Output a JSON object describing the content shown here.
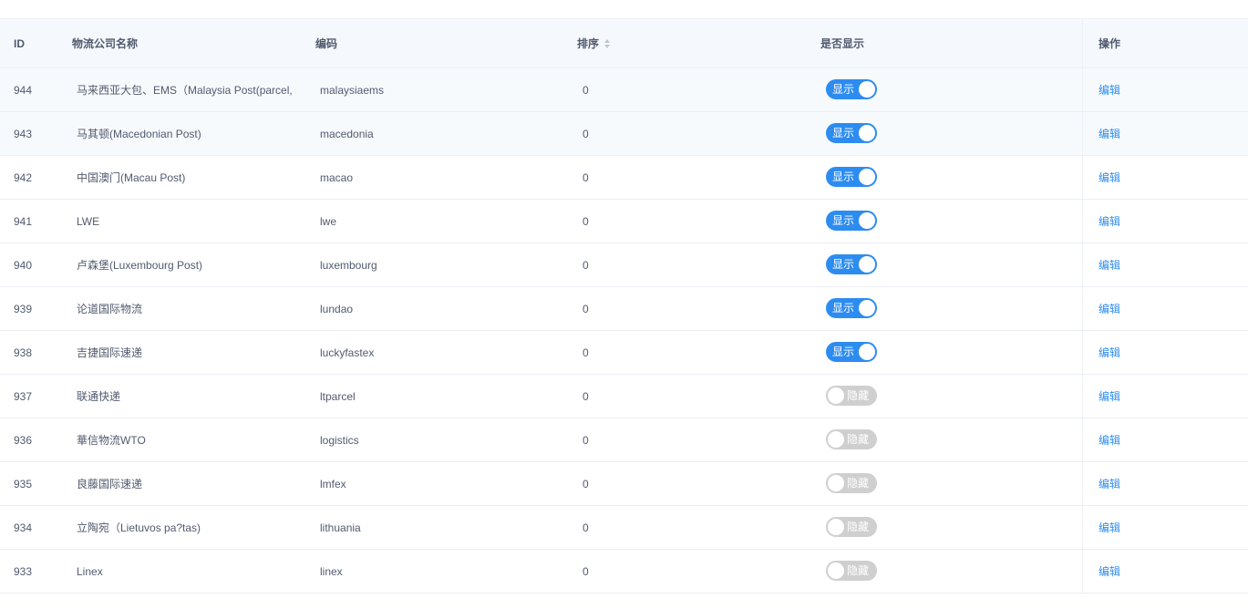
{
  "columns": {
    "id": "ID",
    "name": "物流公司名称",
    "code": "编码",
    "sort": "排序",
    "show": "是否显示",
    "op": "操作"
  },
  "colors": {
    "switch_on": "#2d8cf0",
    "switch_off": "#cfcfcf",
    "link": "#2d8cf0",
    "header_bg": "#f5f8fc"
  },
  "rows": [
    {
      "id": "944",
      "name": "马来西亚大包、EMS（Malaysia Post(parcel,",
      "code": "malaysiaems",
      "sort": "0",
      "show": true,
      "show_label": "显示",
      "op_label": "编辑"
    },
    {
      "id": "943",
      "name": "马其顿(Macedonian Post)",
      "code": "macedonia",
      "sort": "0",
      "show": true,
      "show_label": "显示",
      "op_label": "编辑"
    },
    {
      "id": "942",
      "name": "中国澳门(Macau Post)",
      "code": "macao",
      "sort": "0",
      "show": true,
      "show_label": "显示",
      "op_label": "编辑"
    },
    {
      "id": "941",
      "name": "LWE",
      "code": "lwe",
      "sort": "0",
      "show": true,
      "show_label": "显示",
      "op_label": "编辑"
    },
    {
      "id": "940",
      "name": "卢森堡(Luxembourg Post)",
      "code": "luxembourg",
      "sort": "0",
      "show": true,
      "show_label": "显示",
      "op_label": "编辑"
    },
    {
      "id": "939",
      "name": "论道国际物流",
      "code": "lundao",
      "sort": "0",
      "show": true,
      "show_label": "显示",
      "op_label": "编辑"
    },
    {
      "id": "938",
      "name": "吉捷国际速递",
      "code": "luckyfastex",
      "sort": "0",
      "show": true,
      "show_label": "显示",
      "op_label": "编辑"
    },
    {
      "id": "937",
      "name": "联通快递",
      "code": "ltparcel",
      "sort": "0",
      "show": false,
      "show_label": "隐藏",
      "op_label": "编辑"
    },
    {
      "id": "936",
      "name": "華信物流WTO",
      "code": "logistics",
      "sort": "0",
      "show": false,
      "show_label": "隐藏",
      "op_label": "编辑"
    },
    {
      "id": "935",
      "name": "良藤国际速递",
      "code": "lmfex",
      "sort": "0",
      "show": false,
      "show_label": "隐藏",
      "op_label": "编辑"
    },
    {
      "id": "934",
      "name": "立陶宛（Lietuvos pa?tas)",
      "code": "lithuania",
      "sort": "0",
      "show": false,
      "show_label": "隐藏",
      "op_label": "编辑"
    },
    {
      "id": "933",
      "name": "Linex",
      "code": "linex",
      "sort": "0",
      "show": false,
      "show_label": "隐藏",
      "op_label": "编辑"
    }
  ]
}
